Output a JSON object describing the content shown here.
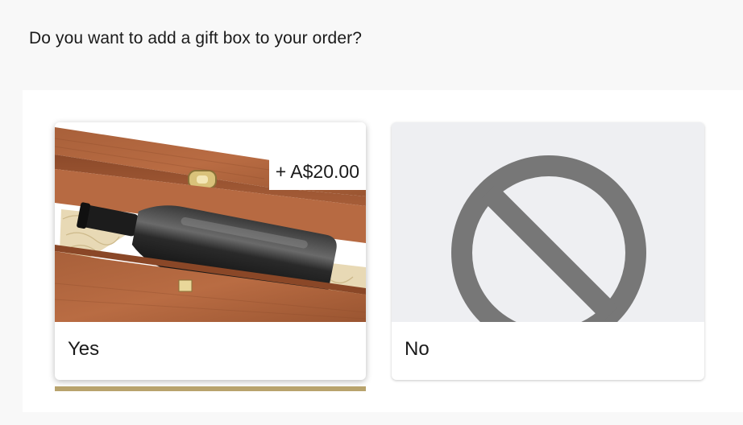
{
  "question": "Do you want to add a gift box to your order?",
  "options": [
    {
      "label": "Yes",
      "price": "+ A$20.00",
      "image": "wooden-wine-gift-box",
      "selected": true
    },
    {
      "label": "No",
      "image": "prohibited-icon",
      "selected": false
    }
  ],
  "colors": {
    "page_bg": "#f8f8f8",
    "panel_bg": "#ffffff",
    "selected_accent": "#b8a36d",
    "no_icon": "#777777",
    "no_media_bg": "#eeeff2"
  }
}
